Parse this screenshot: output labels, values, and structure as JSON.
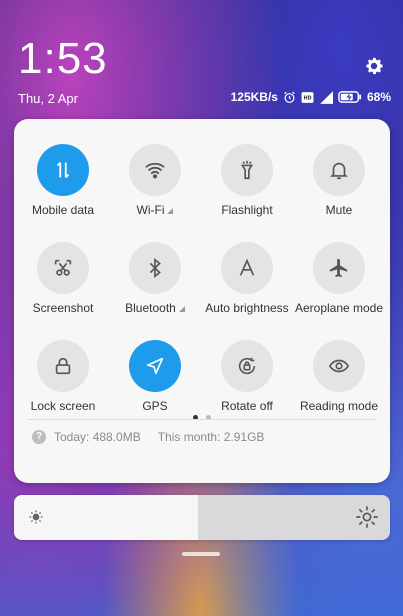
{
  "status_bar": {
    "time": "1:53",
    "date": "Thu, 2 Apr",
    "network_speed": "125KB/s",
    "battery_percent": "68%",
    "icons": [
      "alarm-icon",
      "volte-icon",
      "signal-icon",
      "battery-charging-icon"
    ]
  },
  "tiles": [
    {
      "label": "Mobile data",
      "icon": "mobile-data-icon",
      "active": true,
      "has_dropdown": false
    },
    {
      "label": "Wi-Fi",
      "icon": "wifi-icon",
      "active": false,
      "has_dropdown": true
    },
    {
      "label": "Flashlight",
      "icon": "flashlight-icon",
      "active": false,
      "has_dropdown": false
    },
    {
      "label": "Mute",
      "icon": "bell-icon",
      "active": false,
      "has_dropdown": false
    },
    {
      "label": "Screenshot",
      "icon": "scissors-icon",
      "active": false,
      "has_dropdown": false
    },
    {
      "label": "Bluetooth",
      "icon": "bluetooth-icon",
      "active": false,
      "has_dropdown": true
    },
    {
      "label": "Auto brightness",
      "icon": "auto-brightness-icon",
      "active": false,
      "has_dropdown": false
    },
    {
      "label": "Aeroplane mode",
      "icon": "airplane-icon",
      "active": false,
      "has_dropdown": false
    },
    {
      "label": "Lock screen",
      "icon": "lock-icon",
      "active": false,
      "has_dropdown": false
    },
    {
      "label": "GPS",
      "icon": "location-arrow-icon",
      "active": true,
      "has_dropdown": false
    },
    {
      "label": "Rotate off",
      "icon": "rotation-lock-icon",
      "active": false,
      "has_dropdown": false
    },
    {
      "label": "Reading mode",
      "icon": "eye-icon",
      "active": false,
      "has_dropdown": false
    }
  ],
  "page_indicator": {
    "pages": 2,
    "current": 1
  },
  "usage": {
    "today": "Today: 488.0MB",
    "month": "This month: 2.91GB"
  },
  "brightness": {
    "level_fraction": 0.49
  },
  "colors": {
    "accent": "#1e9bea",
    "tile_off": "#e4e4e6",
    "panel": "#f7f7f8"
  }
}
